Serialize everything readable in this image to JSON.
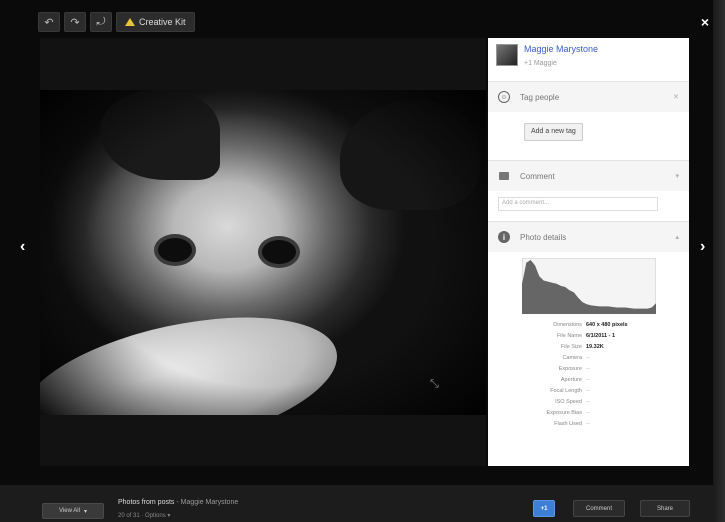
{
  "toolbar": {
    "undo_label": "↶",
    "redo_label": "↷",
    "rotate_label": "⤾",
    "creative_label": "Creative Kit"
  },
  "close_label": "×",
  "nav": {
    "prev": "‹",
    "next": "›"
  },
  "owner": {
    "name": "Maggie Marystone",
    "sub": "+1 Maggie"
  },
  "tag_people": {
    "title": "Tag people",
    "button": "Add a new tag"
  },
  "comment": {
    "title": "Comment",
    "placeholder": "Add a comment..."
  },
  "photo_details": {
    "title": "Photo details",
    "rows": [
      {
        "key": "Dimensions",
        "value": "640 x 480 pixels"
      },
      {
        "key": "File Name",
        "value": "6/1/2011 - 1"
      },
      {
        "key": "File Size",
        "value": "19.32K"
      },
      {
        "key": "Camera",
        "value": "--"
      },
      {
        "key": "Exposure",
        "value": "--"
      },
      {
        "key": "Aperture",
        "value": "--"
      },
      {
        "key": "Focal Length",
        "value": "--"
      },
      {
        "key": "ISO Speed",
        "value": "--"
      },
      {
        "key": "Exposure Bias",
        "value": "--"
      },
      {
        "key": "Flash Used",
        "value": "--"
      }
    ]
  },
  "histogram": {
    "values": [
      0.55,
      0.95,
      1.0,
      0.9,
      0.7,
      0.62,
      0.6,
      0.58,
      0.56,
      0.52,
      0.5,
      0.44,
      0.4,
      0.3,
      0.22,
      0.18,
      0.16,
      0.15,
      0.14,
      0.14,
      0.14,
      0.13,
      0.12,
      0.12,
      0.12,
      0.11,
      0.1,
      0.1,
      0.1,
      0.1,
      0.12,
      0.2
    ]
  },
  "bottom": {
    "view_all": "View All",
    "view_all_caret": "▾",
    "album_title": "Photos from posts",
    "album_sep": " - ",
    "album_owner": "Maggie Marystone",
    "counter": "20 of 31 · Options ▾",
    "plus_one": "+1",
    "comment_label": "Comment",
    "share_label": "Share"
  }
}
